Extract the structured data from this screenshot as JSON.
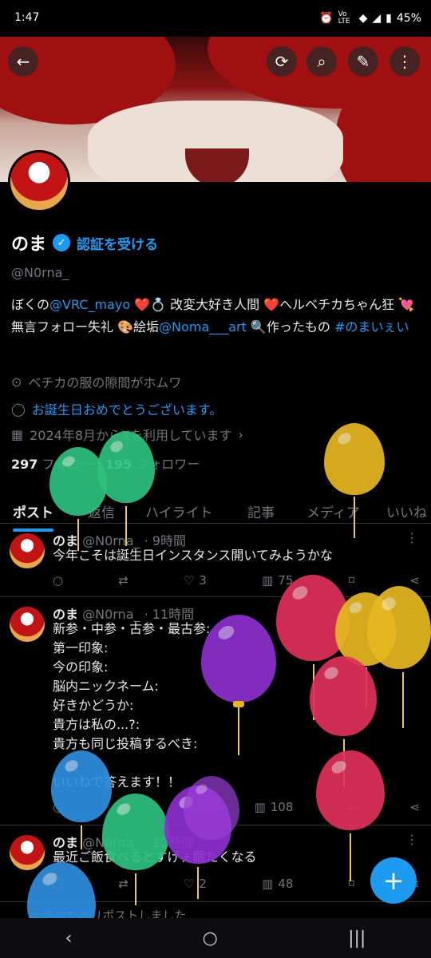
{
  "status_bar": {
    "time": "1:47",
    "network": "Vo LTE",
    "battery": "45%"
  },
  "toolbar": {
    "back_icon": "←",
    "refresh_icon": "⟳",
    "search_icon": "⌕",
    "edit_icon": "✎",
    "more_icon": "⋮"
  },
  "profile": {
    "name": "のま",
    "verify_link": "認証を受ける",
    "handle": "@N0rna_",
    "bio": {
      "p1": "ぼくの",
      "l1": "@VRC_mayo",
      "p2": " ❤️💍 改変大好き人間 ❤️ヘルベチカちゃん狂 💘無言フォロー失礼 🎨絵垢",
      "l2": "@Noma___art",
      "p3": " 🔍作ったもの ",
      "l3": "#のまいぇい"
    },
    "location": "ベチカの服の隙間がホムワ",
    "birthday": "お誕生日おめでとうございます。",
    "joined": "2024年8月からXを利用しています",
    "following_count": "297",
    "following_label": "フォロー",
    "followers_count": "195",
    "followers_label": "フォロワー"
  },
  "tabs": [
    "ポスト",
    "返信",
    "ハイライト",
    "記事",
    "メディア",
    "いいね"
  ],
  "tweets": [
    {
      "name": "のま",
      "handle": "@N0rna_ · 9時間",
      "text": "今年こそは誕生日インスタンス開いてみようかな",
      "likes": "3",
      "views": "75"
    },
    {
      "name": "のま",
      "handle": "@N0rna_ · 11時間",
      "text": "新参・中参・古参・最古参:\n第一印象:\n今の印象:\n脳内ニックネーム:\n好きかどうか:\n貴方は私の...?:\n貴方も同じ投稿するべき:\n\nいいねで答えます！！",
      "likes": "",
      "views": "108"
    },
    {
      "name": "のま",
      "handle": "@N0rna_ · 12時間",
      "text": "最近ご飯食べるとすげぇ眠たくなる",
      "likes": "2",
      "views": "48"
    }
  ],
  "repost_notice": "あなたがリポストしました",
  "fab_icon": "+",
  "nav": {
    "back": "‹",
    "home": "○",
    "recents": "|||"
  }
}
